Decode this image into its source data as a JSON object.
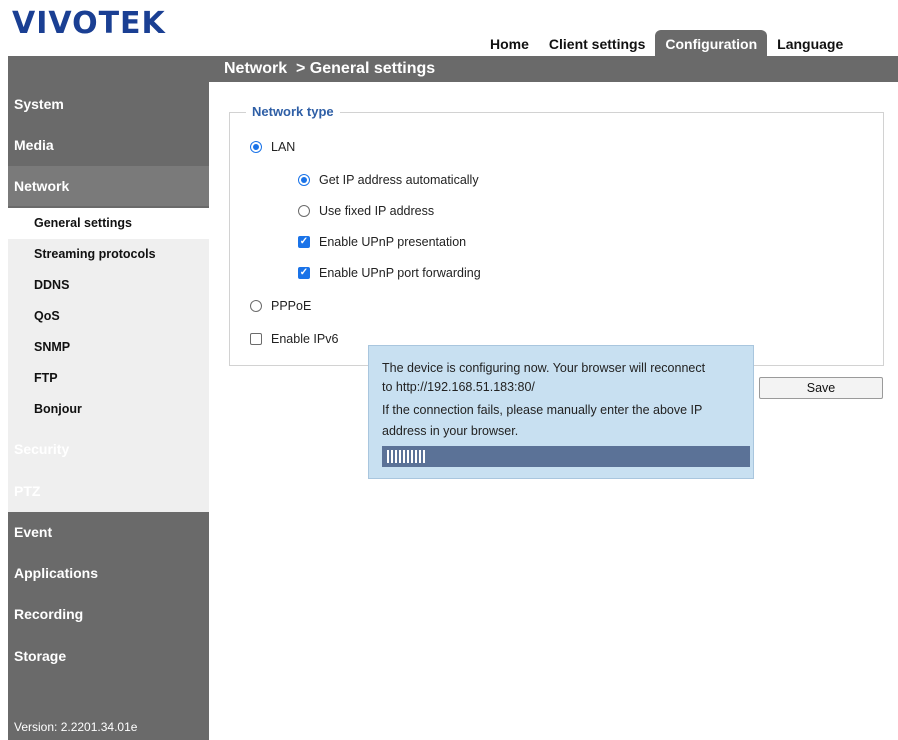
{
  "brand": {
    "logo_text": "VIVOTEK",
    "logo_color": "#1a3f93"
  },
  "topnav": {
    "tabs": [
      {
        "label": "Home"
      },
      {
        "label": "Client settings"
      },
      {
        "label": "Configuration",
        "active": true
      },
      {
        "label": "Language"
      }
    ]
  },
  "header": {
    "breadcrumb": "Network  > General settings"
  },
  "sidebar": {
    "items": [
      {
        "label": "System"
      },
      {
        "label": "Media"
      },
      {
        "label": "Network",
        "expanded": true
      },
      {
        "label": "Security"
      },
      {
        "label": "PTZ"
      },
      {
        "label": "Event"
      },
      {
        "label": "Applications"
      },
      {
        "label": "Recording"
      },
      {
        "label": "Storage"
      }
    ],
    "network_subitems": [
      {
        "label": "General settings",
        "active": true
      },
      {
        "label": "Streaming protocols"
      },
      {
        "label": "DDNS"
      },
      {
        "label": "QoS"
      },
      {
        "label": "SNMP"
      },
      {
        "label": "FTP"
      },
      {
        "label": "Bonjour"
      }
    ],
    "version": "Version: 2.2201.34.01e"
  },
  "network_type": {
    "legend": "Network type",
    "lan": {
      "label": "LAN",
      "selected": true
    },
    "get_ip_auto": {
      "label": "Get IP address automatically",
      "selected": true
    },
    "fixed_ip": {
      "label": "Use fixed IP address",
      "selected": false
    },
    "upnp_presentation": {
      "label": "Enable UPnP presentation",
      "checked": true
    },
    "upnp_port_forwarding": {
      "label": "Enable UPnP port forwarding",
      "checked": true
    },
    "pppoe": {
      "label": "PPPoE",
      "selected": false
    },
    "ipv6": {
      "label": "Enable IPv6",
      "checked": false
    }
  },
  "save_label": "Save",
  "dialog": {
    "line1": "The device is configuring now. Your browser will reconnect",
    "line2": "to http://192.168.51.183:80/",
    "line3": "If the connection fails, please manually enter the above IP",
    "line4": "address in your browser.",
    "progress_fraction": 0.11
  },
  "colors": {
    "sidebar_bg": "#6a6a6a",
    "accent_blue": "#1a73e8",
    "legend_blue": "#2f5fa6",
    "dialog_bg": "#c8e0f1",
    "progress_bg": "#5b7297"
  }
}
